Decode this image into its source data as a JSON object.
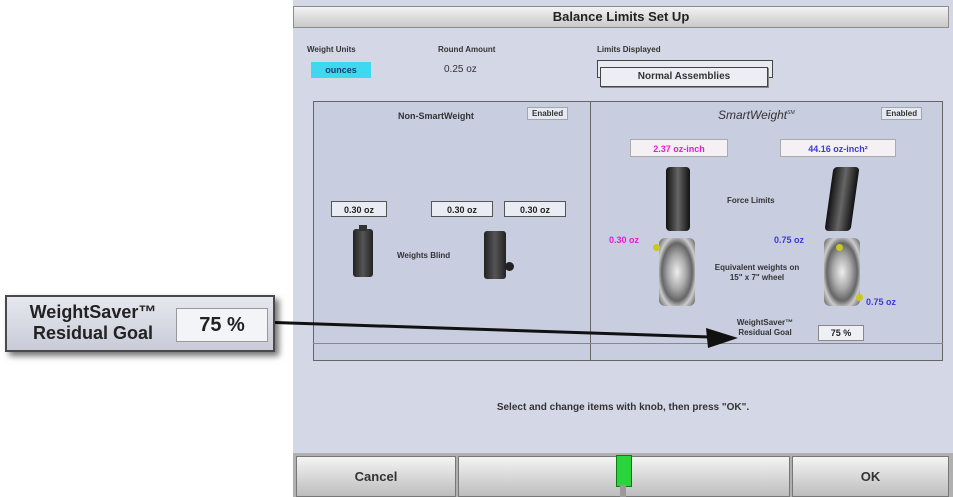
{
  "window": {
    "title": "Balance Limits Set Up"
  },
  "weight_units": {
    "label": "Weight Units",
    "value": "ounces"
  },
  "round_amount": {
    "label": "Round Amount",
    "value": "0.25 oz"
  },
  "limits_displayed": {
    "label": "Limits Displayed",
    "value": "Normal Assemblies"
  },
  "non_smartweight": {
    "title": "Non-SmartWeight",
    "status": "Enabled",
    "weights": [
      "0.30 oz",
      "0.30 oz",
      "0.30 oz"
    ],
    "blind_label": "Weights Blind"
  },
  "smartweight": {
    "title": "SmartWeight",
    "title_mark": "SM",
    "status": "Enabled",
    "static_force": "2.37 oz-inch",
    "couple_force": "44.16 oz-inch²",
    "force_limits_label": "Force Limits",
    "left_weight": "0.30 oz",
    "right_weight_top": "0.75 oz",
    "right_weight_bottom": "0.75 oz",
    "equivalent_label": "Equivalent weights on 15\" x 7\" wheel",
    "weightsaver_label": "WeightSaver™ Residual Goal",
    "weightsaver_value": "75 %"
  },
  "instruction": "Select and change items with knob, then press \"OK\".",
  "buttons": {
    "cancel": "Cancel",
    "ok": "OK"
  },
  "callout": {
    "label": "WeightSaver™ Residual Goal",
    "value": "75 %"
  },
  "colors": {
    "units_highlight": "#3ed8f0",
    "static_force": "#e020d0",
    "couple_force": "#3a3ad8",
    "knob_indicator": "#2ad43a"
  }
}
